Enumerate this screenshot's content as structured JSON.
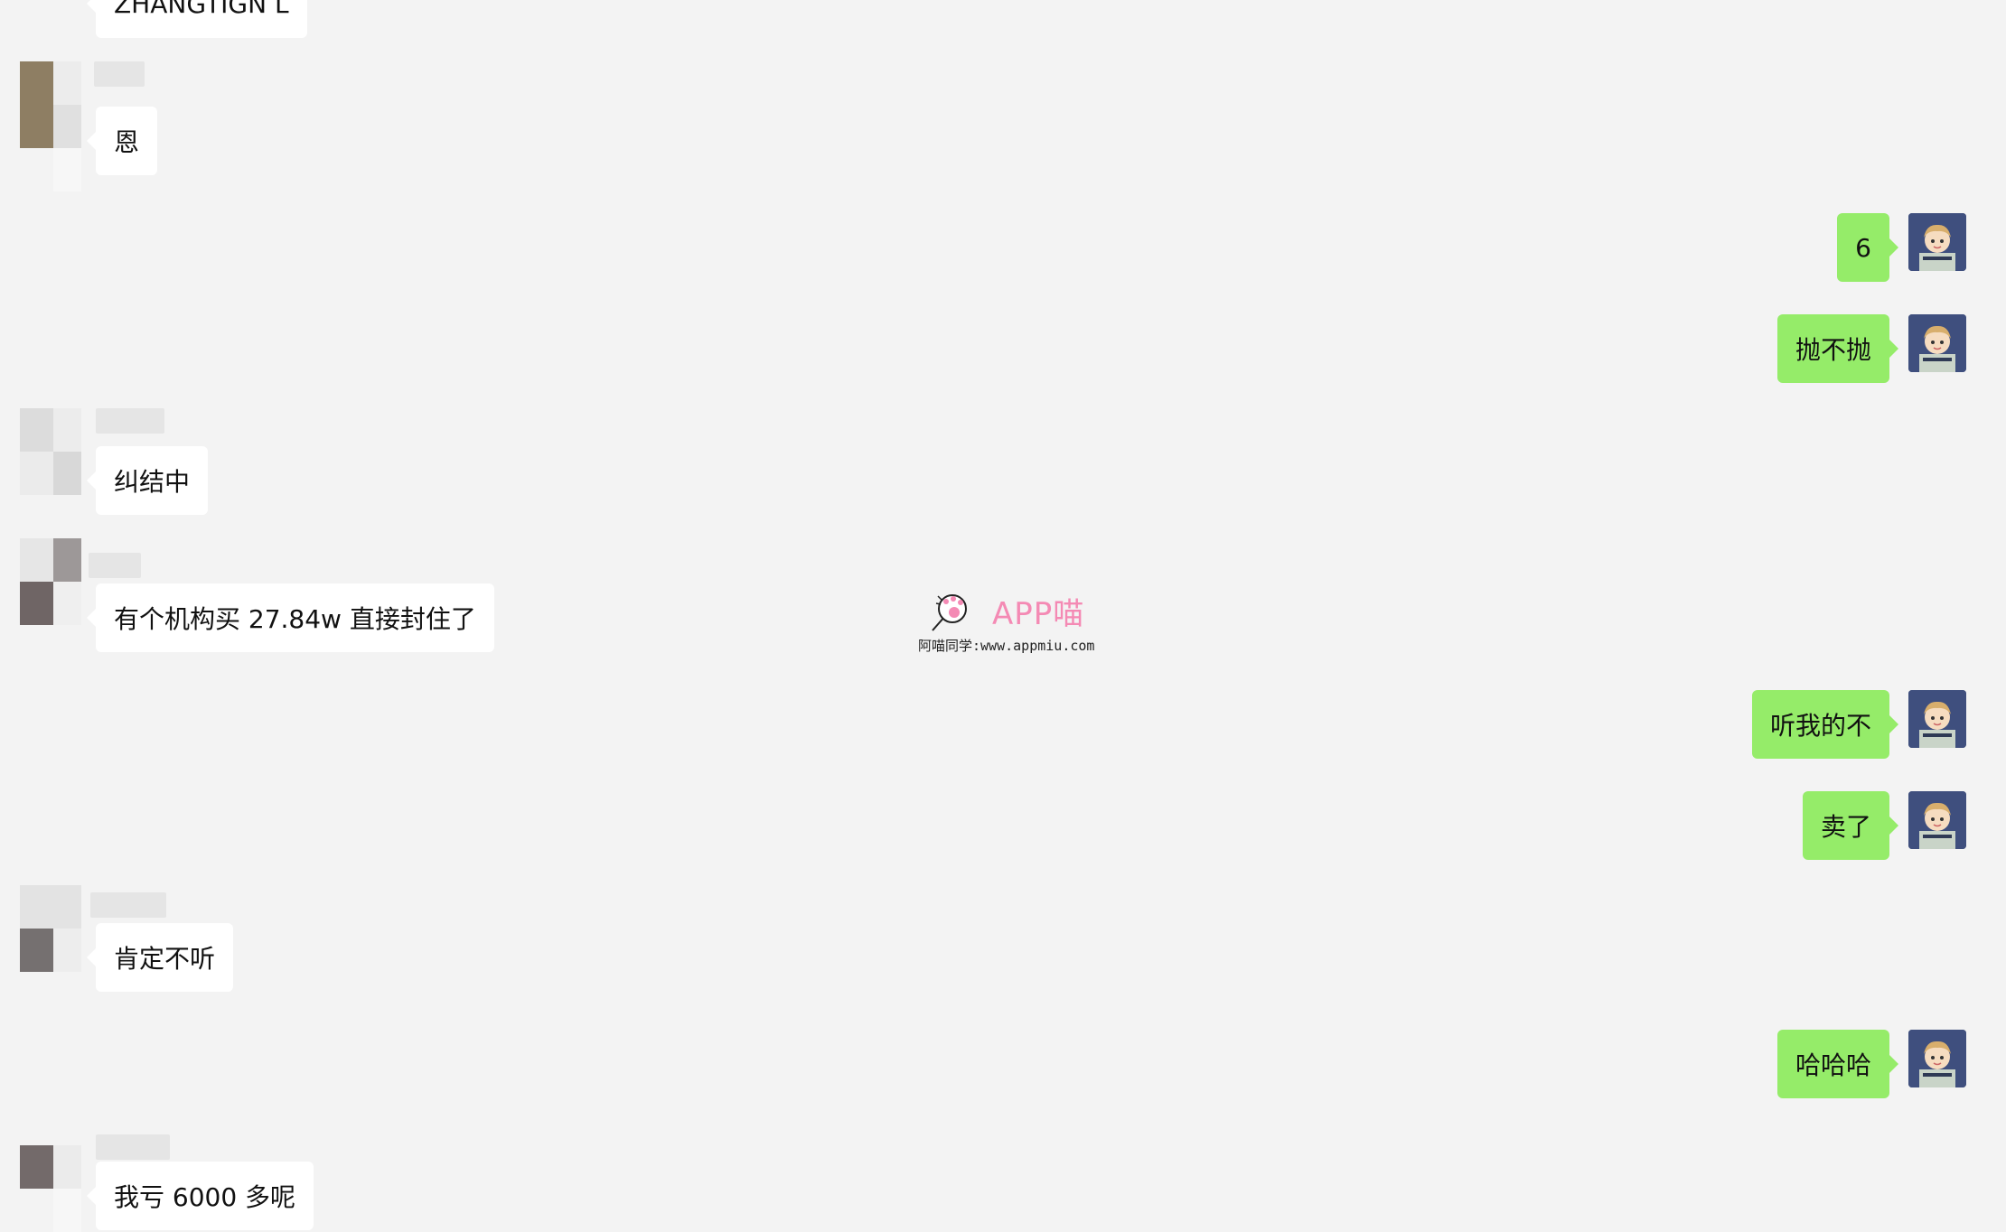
{
  "messages": [
    {
      "id": "m0",
      "side": "in",
      "text": "ZHANGTIGN L"
    },
    {
      "id": "m1",
      "side": "in",
      "text": "恩"
    },
    {
      "id": "m2",
      "side": "out",
      "text": "6"
    },
    {
      "id": "m3",
      "side": "out",
      "text": "抛不抛"
    },
    {
      "id": "m4",
      "side": "in",
      "text": "纠结中"
    },
    {
      "id": "m5",
      "side": "in",
      "text": "有个机构买 27.84w 直接封住了"
    },
    {
      "id": "m6",
      "side": "out",
      "text": "听我的不"
    },
    {
      "id": "m7",
      "side": "out",
      "text": "卖了"
    },
    {
      "id": "m8",
      "side": "in",
      "text": "肯定不听"
    },
    {
      "id": "m9",
      "side": "out",
      "text": "哈哈哈"
    },
    {
      "id": "m10",
      "side": "in",
      "text": "我亏 6000 多呢"
    }
  ],
  "watermark": {
    "title": "APP喵",
    "subtitle": "阿喵同学:www.appmiu.com"
  },
  "colors": {
    "background": "#f3f3f3",
    "incoming_bubble": "#ffffff",
    "outgoing_bubble": "#95ec69",
    "watermark_accent": "#f48ab4",
    "self_avatar_bg": "#3f4f7e"
  },
  "icons": {
    "self_avatar": "cartoon-boy-avatar-icon",
    "watermark_logo": "cat-paw-logo-icon"
  }
}
